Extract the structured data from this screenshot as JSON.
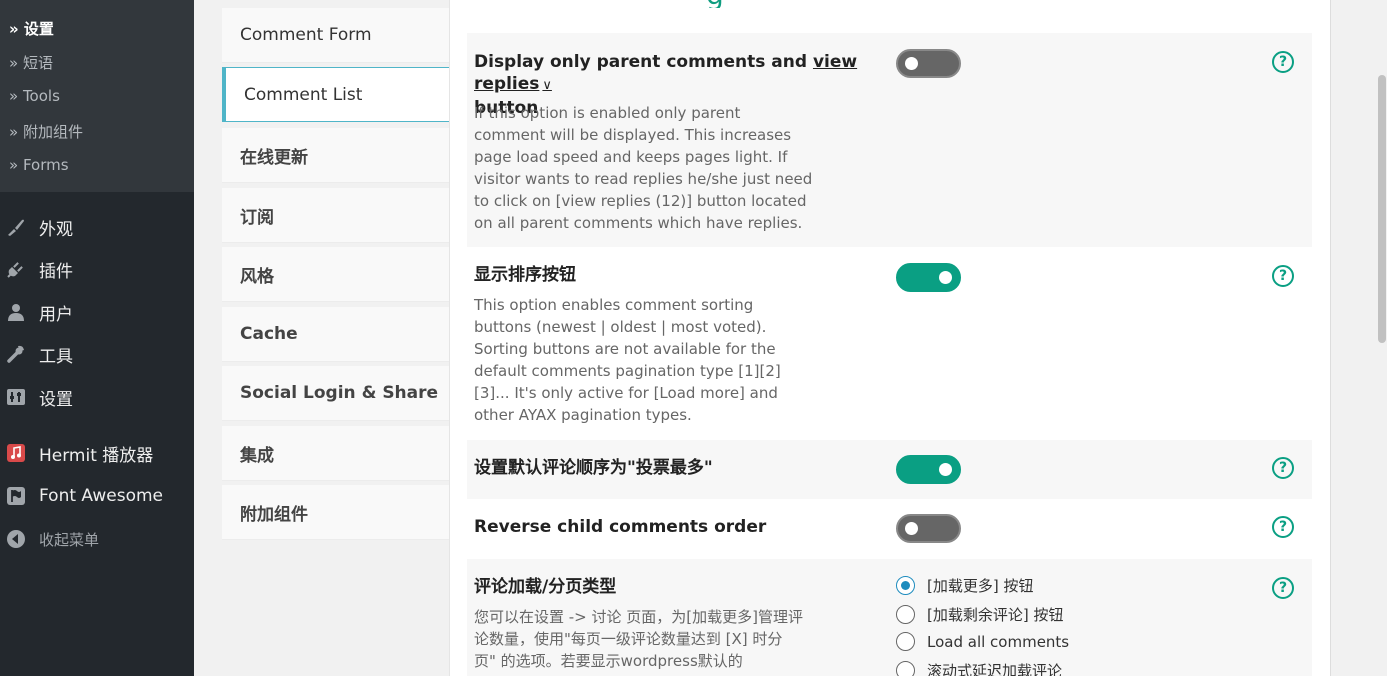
{
  "sidebar": {
    "submenu": [
      {
        "label": "» 设置",
        "current": true
      },
      {
        "label": "» 短语"
      },
      {
        "label": "» Tools"
      },
      {
        "label": "» 附加组件"
      },
      {
        "label": "» Forms"
      }
    ],
    "menu": [
      {
        "label": "外观",
        "icon": "brush-icon"
      },
      {
        "label": "插件",
        "icon": "plug-icon"
      },
      {
        "label": "用户",
        "icon": "user-icon"
      },
      {
        "label": "工具",
        "icon": "wrench-icon"
      },
      {
        "label": "设置",
        "icon": "settings-sliders-icon"
      },
      {
        "label": "Hermit 播放器",
        "icon": "music-icon"
      },
      {
        "label": "Font Awesome",
        "icon": "flag-icon"
      }
    ],
    "collapse_label": "收起菜单"
  },
  "tabs": [
    {
      "label": "Comment Form"
    },
    {
      "label": "Comment List",
      "active": true
    },
    {
      "label": "在线更新"
    },
    {
      "label": "订阅"
    },
    {
      "label": "风格"
    },
    {
      "label": "Cache"
    },
    {
      "label": "Social Login & Share"
    },
    {
      "label": "集成"
    },
    {
      "label": "附加组件"
    }
  ],
  "settings": {
    "parent_comments": {
      "title_pre": "Display only parent comments and",
      "title_link": "view replies",
      "title_chevron": "∨",
      "title_post": "button",
      "desc": "If this option is enabled only parent comment will be displayed. This increases page load speed and keeps pages light. If visitor wants to read replies he/she just need to click on [view replies (12)] button located on all parent comments which have replies.",
      "enabled": false
    },
    "sorting_buttons": {
      "title": "显示排序按钮",
      "desc": "This option enables comment sorting buttons (newest | oldest | most voted). Sorting buttons are not available for the default comments pagination type [1][2][3]... It's only active for [Load more] and other AYAX pagination types.",
      "enabled": true
    },
    "default_order": {
      "title": "设置默认评论顺序为\"投票最多\"",
      "enabled": true
    },
    "reverse_child": {
      "title": "Reverse child comments order",
      "enabled": false
    },
    "pagination": {
      "title": "评论加载/分页类型",
      "desc": "您可以在设置 -> 讨论 页面，为[加载更多]管理评论数量，使用\"每页一级评论数量达到 [X] 时分页\" 的选项。若要显示wordpress默认的",
      "options": [
        {
          "label": "[加载更多] 按钮",
          "checked": true
        },
        {
          "label": "[加载剩余评论] 按钮"
        },
        {
          "label": "Load all comments"
        },
        {
          "label": "滚动式延迟加载评论"
        }
      ]
    },
    "help_glyph": "?"
  }
}
